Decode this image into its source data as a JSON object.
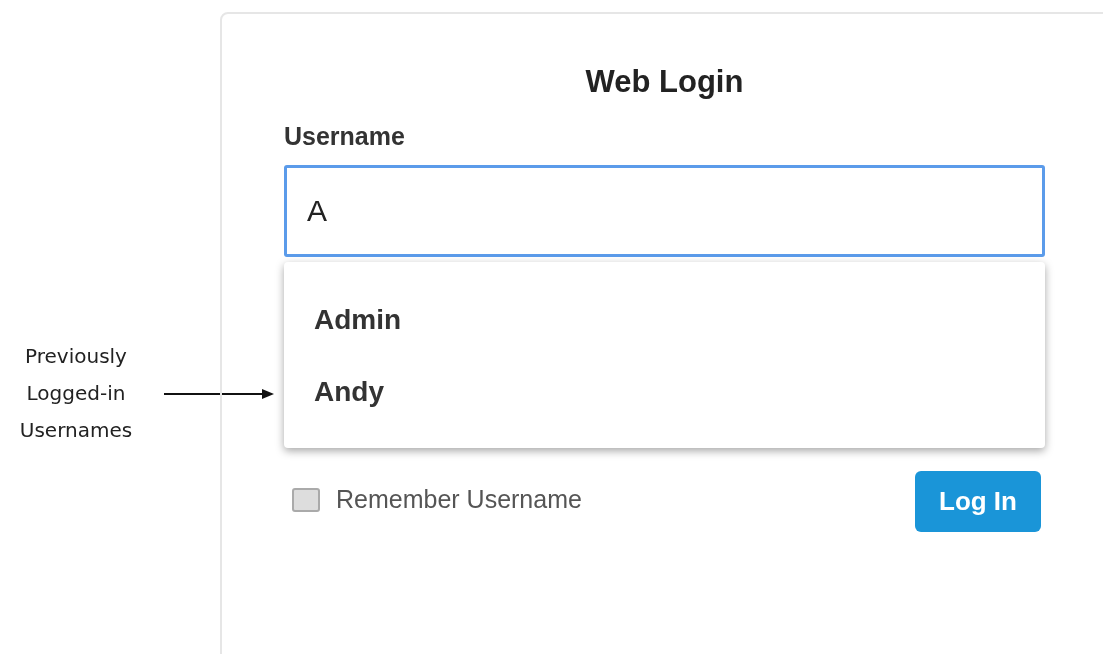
{
  "annotation": {
    "text": "Previously Logged-in Usernames"
  },
  "login": {
    "title": "Web Login",
    "username_label": "Username",
    "username_value": "A",
    "suggestions": [
      {
        "label": "Admin"
      },
      {
        "label": "Andy"
      }
    ],
    "remember": {
      "label": "Remember Username",
      "checked": false
    },
    "button": "Log In"
  }
}
